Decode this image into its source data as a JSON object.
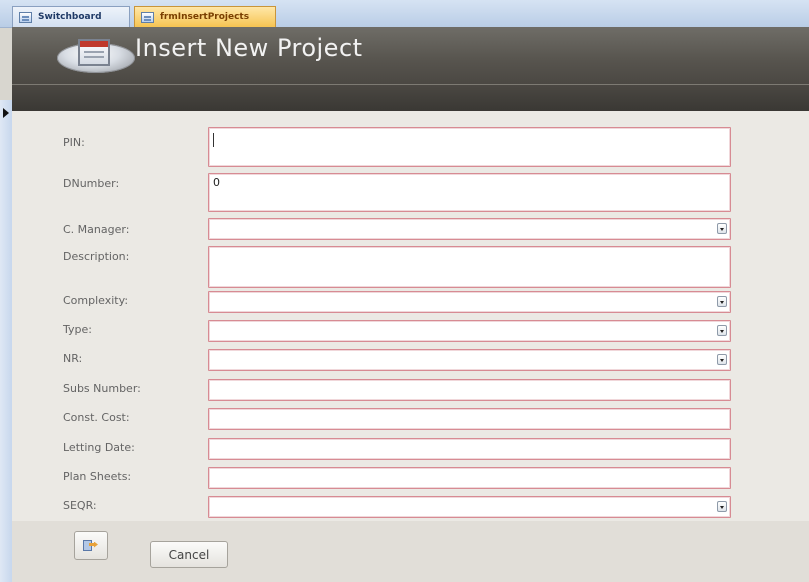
{
  "tabs": [
    {
      "label": "Switchboard"
    },
    {
      "label": "frmInsertProjects"
    }
  ],
  "header": {
    "title": "Insert New Project"
  },
  "form": {
    "fields": [
      {
        "label": "PIN:",
        "value": "",
        "type": "text"
      },
      {
        "label": "DNumber:",
        "value": "0",
        "type": "text"
      },
      {
        "label": "C. Manager:",
        "value": "",
        "type": "combo"
      },
      {
        "label": "Description:",
        "value": "",
        "type": "text"
      },
      {
        "label": "Complexity:",
        "value": "",
        "type": "combo"
      },
      {
        "label": "Type:",
        "value": "",
        "type": "combo"
      },
      {
        "label": "NR:",
        "value": "",
        "type": "combo"
      },
      {
        "label": "Subs Number:",
        "value": "",
        "type": "text"
      },
      {
        "label": "Const. Cost:",
        "value": "",
        "type": "text"
      },
      {
        "label": "Letting Date:",
        "value": "",
        "type": "text"
      },
      {
        "label": "Plan Sheets:",
        "value": "",
        "type": "text"
      },
      {
        "label": "SEQR:",
        "value": "",
        "type": "combo"
      }
    ]
  },
  "footer": {
    "cancel_label": "Cancel",
    "save_icon": "save-arrow-icon"
  }
}
